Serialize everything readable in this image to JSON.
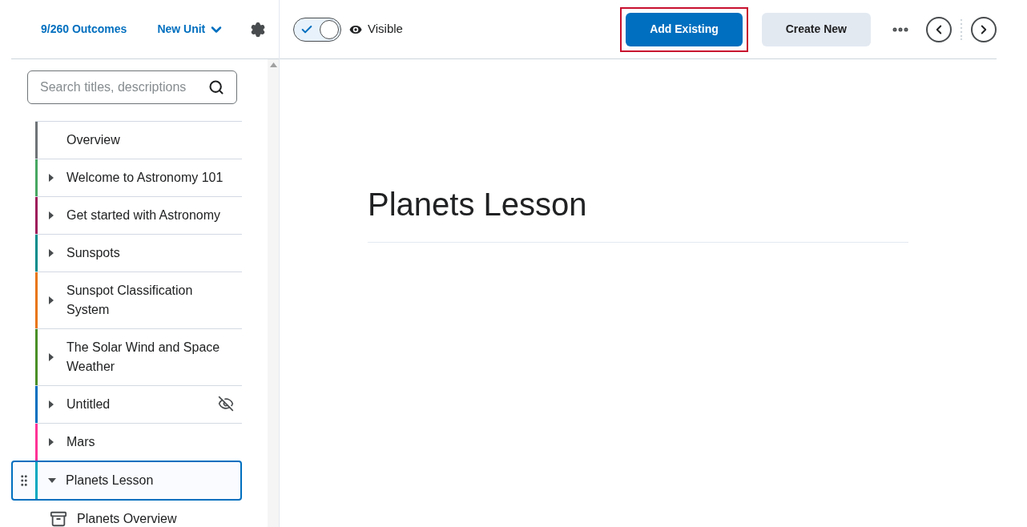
{
  "sidebar": {
    "outcomes_link": "9/260 Outcomes",
    "unit_menu": "New Unit",
    "search": {
      "placeholder": "Search titles, descriptions"
    },
    "items": [
      {
        "kind": "page",
        "title": "Overview",
        "color": "#6e7376",
        "selected": false,
        "hidden": false
      },
      {
        "kind": "unit",
        "title": "Welcome to Astronomy 101",
        "color": "#46a661",
        "expanded": false,
        "selected": false,
        "hidden": false
      },
      {
        "kind": "unit",
        "title": "Get started with Astronomy",
        "color": "#9d1d5a",
        "expanded": false,
        "selected": false,
        "hidden": false
      },
      {
        "kind": "unit",
        "title": "Sunspots",
        "color": "#008b8b",
        "expanded": false,
        "selected": false,
        "hidden": false
      },
      {
        "kind": "unit",
        "title": "Sunspot Classification System",
        "color": "#e87511",
        "expanded": false,
        "selected": false,
        "hidden": false
      },
      {
        "kind": "unit",
        "title": "The Solar Wind and Space Weather",
        "color": "#4a8f26",
        "expanded": false,
        "selected": false,
        "hidden": false
      },
      {
        "kind": "unit",
        "title": "Untitled",
        "color": "#006fbf",
        "expanded": false,
        "selected": false,
        "hidden": true
      },
      {
        "kind": "unit",
        "title": "Mars",
        "color": "#ff3296",
        "expanded": false,
        "selected": false,
        "hidden": false
      },
      {
        "kind": "unit",
        "title": "Planets Lesson",
        "color": "#00a8c0",
        "expanded": true,
        "selected": true,
        "hidden": false,
        "children": [
          {
            "title": "Planets Overview"
          }
        ]
      }
    ]
  },
  "toolbar": {
    "visibility": {
      "on": true,
      "label": "Visible"
    },
    "buttons": [
      {
        "label": "Add Existing",
        "kind": "primary",
        "highlighted": true
      },
      {
        "label": "Create New",
        "kind": "secondary",
        "highlighted": false
      }
    ]
  },
  "content": {
    "title": "Planets Lesson"
  }
}
